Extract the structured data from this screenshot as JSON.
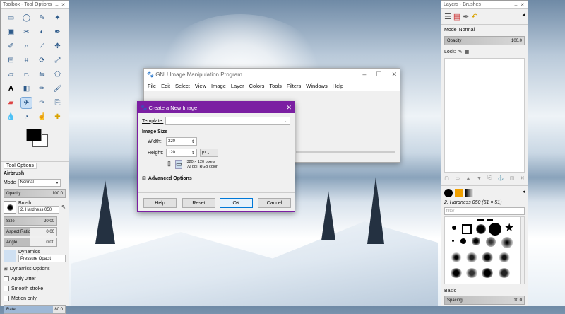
{
  "toolbox": {
    "title": "Toolbox - Tool Options",
    "tab": "Tool Options",
    "tool_name": "Airbrush",
    "mode_label": "Mode",
    "mode_value": "Normal",
    "opacity_label": "Opacity",
    "opacity_value": "100.0",
    "brush_label": "Brush",
    "brush_value": "2. Hardness 050",
    "size_label": "Size",
    "size_value": "20.00",
    "aspect_label": "Aspect Ratio",
    "aspect_value": "0.00",
    "angle_label": "Angle",
    "angle_value": "0.00",
    "dynamics_label": "Dynamics",
    "dynamics_value": "Pressure Opacit",
    "dyn_options": "Dynamics Options",
    "apply_jitter": "Apply Jitter",
    "smooth_stroke": "Smooth stroke",
    "motion_only": "Motion only",
    "rate_label": "Rate",
    "rate_value": "80.0"
  },
  "gimp": {
    "title": "GNU Image Manipulation Program",
    "menu": [
      "File",
      "Edit",
      "Select",
      "View",
      "Image",
      "Layer",
      "Colors",
      "Tools",
      "Filters",
      "Windows",
      "Help"
    ]
  },
  "dialog": {
    "title": "Create a New Image",
    "template_label": "Template:",
    "template_value": "",
    "size_heading": "Image Size",
    "width_label": "Width:",
    "width_value": "320",
    "height_label": "Height:",
    "height_value": "120",
    "unit": "px",
    "info_line1": "320 × 120 pixels",
    "info_line2": "72 ppi, RGB color",
    "advanced": "Advanced Options",
    "help": "Help",
    "reset": "Reset",
    "ok": "OK",
    "cancel": "Cancel"
  },
  "layers": {
    "title": "Layers - Brushes",
    "mode_label": "Mode",
    "mode_value": "Normal",
    "opacity_label": "Opacity",
    "opacity_value": "100.0",
    "lock_label": "Lock:",
    "brush_name": "2. Hardness 050 (51 × 51)",
    "filter_placeholder": "filter",
    "basic_label": "Basic",
    "spacing_label": "Spacing",
    "spacing_value": "10.0"
  }
}
